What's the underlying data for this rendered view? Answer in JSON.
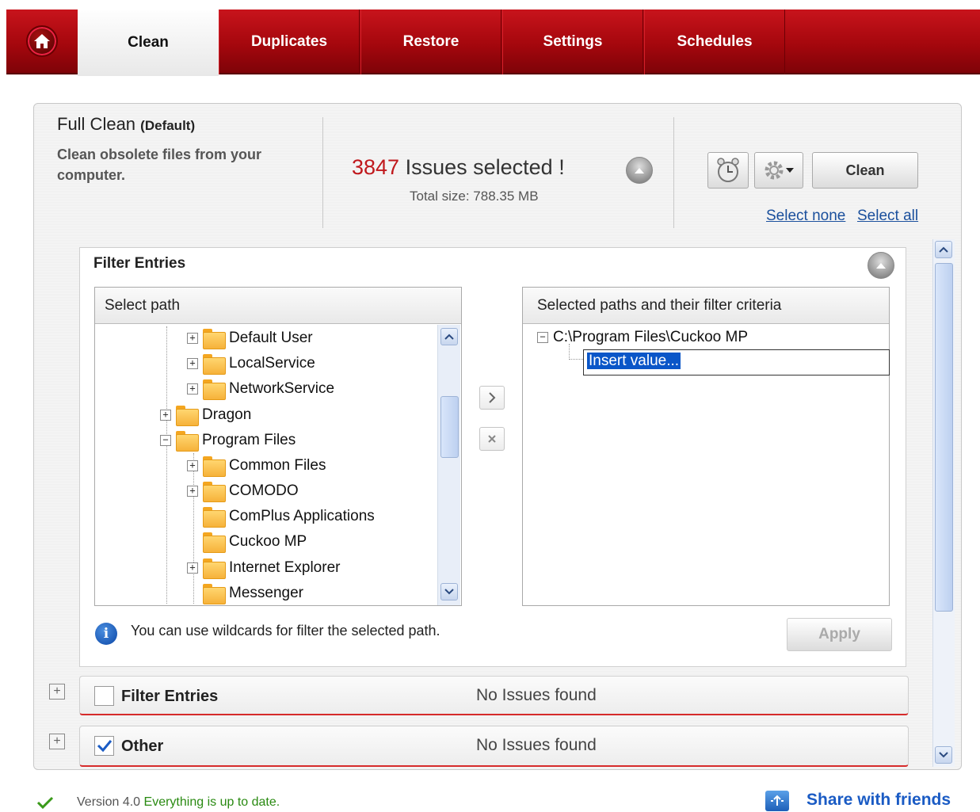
{
  "nav": {
    "tabs": [
      {
        "label": "Clean",
        "active": true
      },
      {
        "label": "Duplicates"
      },
      {
        "label": "Restore"
      },
      {
        "label": "Settings"
      },
      {
        "label": "Schedules"
      }
    ]
  },
  "header": {
    "title": "Full Clean",
    "title_suffix": "(Default)",
    "description": "Clean obsolete files from your computer.",
    "issues_count": "3847",
    "issues_text": "Issues selected !",
    "total_size": "Total size: 788.35 MB",
    "clean_button": "Clean",
    "select_none": "Select none",
    "select_all": "Select all"
  },
  "filter": {
    "heading": "Filter Entries",
    "left_header": "Select path",
    "right_header": "Selected paths and their filter criteria",
    "tree": [
      {
        "label": "Default User",
        "level": 2,
        "expandable": true
      },
      {
        "label": "LocalService",
        "level": 2,
        "expandable": true
      },
      {
        "label": "NetworkService",
        "level": 2,
        "expandable": true
      },
      {
        "label": "Dragon",
        "level": 1,
        "expandable": true
      },
      {
        "label": "Program Files",
        "level": 1,
        "expanded": true
      },
      {
        "label": "Common Files",
        "level": 2,
        "expandable": true
      },
      {
        "label": "COMODO",
        "level": 2,
        "expandable": true
      },
      {
        "label": "ComPlus Applications",
        "level": 2
      },
      {
        "label": "Cuckoo MP",
        "level": 2
      },
      {
        "label": "Internet Explorer",
        "level": 2,
        "expandable": true
      },
      {
        "label": "Messenger",
        "level": 2
      }
    ],
    "selected_path": "C:\\Program Files\\Cuckoo MP",
    "insert_value": "Insert value...",
    "hint": "You can use wildcards for filter the selected path.",
    "apply_button": "Apply"
  },
  "categories": [
    {
      "label": "Filter Entries",
      "status": "No Issues found",
      "checked": false
    },
    {
      "label": "Other",
      "status": "No Issues found",
      "checked": true
    }
  ],
  "statusbar": {
    "version_label": "Version",
    "version_number": "4.0",
    "update_text": "Everything is up to date.",
    "share": "Share with friends"
  },
  "colors": {
    "brand": "#a5070d",
    "link": "#1a4f9c",
    "issues": "#c0181c",
    "ok": "#2a8a12"
  }
}
